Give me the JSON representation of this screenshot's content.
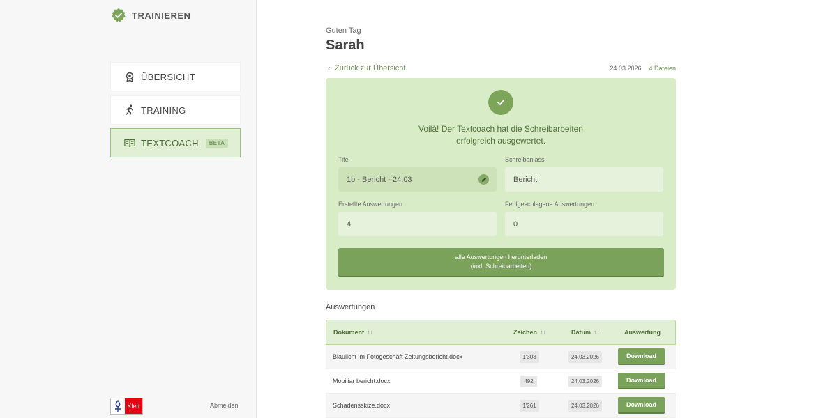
{
  "brand": {
    "title": "TRAINIEREN"
  },
  "nav": {
    "items": [
      {
        "label": "ÜBERSICHT"
      },
      {
        "label": "TRAINING"
      },
      {
        "label": "TEXTCOACH",
        "badge": "BETA"
      }
    ]
  },
  "footer": {
    "logo_text": "Klett",
    "logout": "Abmelden"
  },
  "header": {
    "greeting": "Guten Tag",
    "name": "Sarah"
  },
  "back_link": "Zurück zur Übersicht",
  "meta": {
    "date": "24.03.2026",
    "files": "4 Dateien"
  },
  "result": {
    "message_line1": "Voilà! Der Textcoach hat die Schreibarbeiten",
    "message_line2": "erfolgreich ausgewertet.",
    "title_label": "Titel",
    "title_value": "1b - Bericht - 24.03",
    "occasion_label": "Schreibanlass",
    "occasion_value": "Bericht",
    "created_label": "Erstellte Auswertungen",
    "created_value": "4",
    "failed_label": "Fehlgeschlagene Auswertungen",
    "failed_value": "0",
    "download_all_line1": "alle Auswertungen herunterladen",
    "download_all_line2": "(inkl. Schreibarbeiten)"
  },
  "table": {
    "section_title": "Auswertungen",
    "headers": {
      "document": "Dokument",
      "chars": "Zeichen",
      "date": "Datum",
      "eval": "Auswertung"
    },
    "sort_glyph": "↑↓",
    "rows": [
      {
        "document": "Blaulicht im Fotogeschäft Zeitungsbericht.docx",
        "chars": "1'303",
        "date": "24.03.2026",
        "action": "Download"
      },
      {
        "document": "Mobiliar bericht.docx",
        "chars": "492",
        "date": "24.03.2026",
        "action": "Download"
      },
      {
        "document": "Schadensskize.docx",
        "chars": "1'261",
        "date": "24.03.2026",
        "action": "Download"
      }
    ]
  },
  "colors": {
    "accent": "#7aa25b",
    "panel": "#d9ecc8",
    "klett_red": "#e30613"
  }
}
